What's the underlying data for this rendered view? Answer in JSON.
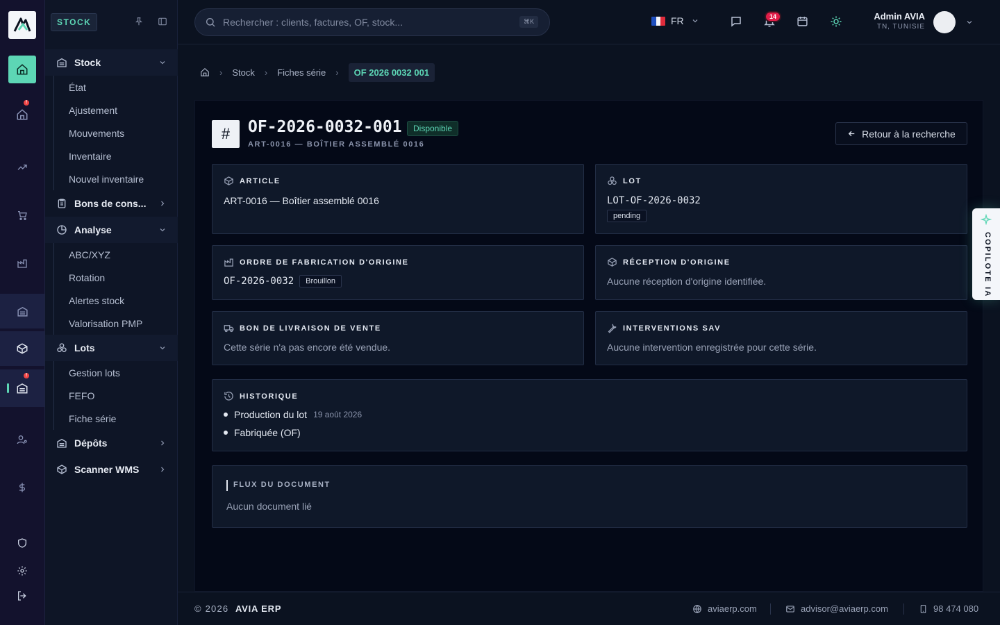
{
  "sidebar": {
    "module_tag": "STOCK",
    "groups": [
      {
        "label": "Stock",
        "items": [
          "État",
          "Ajustement",
          "Mouvements",
          "Inventaire",
          "Nouvel inventaire"
        ]
      },
      {
        "label": "Bons de cons..."
      },
      {
        "label": "Analyse",
        "items": [
          "ABC/XYZ",
          "Rotation",
          "Alertes stock",
          "Valorisation PMP"
        ]
      },
      {
        "label": "Lots",
        "items": [
          "Gestion lots",
          "FEFO",
          "Fiche série"
        ]
      },
      {
        "label": "Dépôts"
      },
      {
        "label": "Scanner WMS"
      }
    ]
  },
  "topbar": {
    "search_placeholder": "Rechercher : clients, factures, OF, stock...",
    "search_shortcut": "⌘K",
    "language": "FR",
    "notifications_count": "14",
    "user_name": "Admin AVIA",
    "user_location": "TN, TUNISIE"
  },
  "breadcrumb": [
    "Stock",
    "Fiches série",
    "OF 2026 0032 001"
  ],
  "detail": {
    "title": "OF-2026-0032-001",
    "status": "Disponible",
    "subtitle": "ART-0016 — BOÎTIER ASSEMBLÉ 0016",
    "back_label": "Retour à la recherche",
    "article": {
      "heading": "ARTICLE",
      "value": "ART-0016 — Boîtier assemblé 0016"
    },
    "lot": {
      "heading": "LOT",
      "value": "LOT-OF-2026-0032",
      "chip": "pending"
    },
    "of_origin": {
      "heading": "ORDRE DE FABRICATION D'ORIGINE",
      "value": "OF-2026-0032",
      "chip": "Brouillon"
    },
    "reception": {
      "heading": "RÉCEPTION D'ORIGINE",
      "text": "Aucune réception d'origine identifiée."
    },
    "delivery": {
      "heading": "BON DE LIVRAISON DE VENTE",
      "text": "Cette série n'a pas encore été vendue."
    },
    "sav": {
      "heading": "INTERVENTIONS SAV",
      "text": "Aucune intervention enregistrée pour cette série."
    },
    "history": {
      "heading": "HISTORIQUE",
      "events": [
        {
          "label": "Production du lot",
          "date": "19 août 2026"
        },
        {
          "label": "Fabriquée (OF)",
          "date": ""
        }
      ]
    },
    "flux": {
      "heading": "FLUX DU DOCUMENT",
      "text": "Aucun document lié"
    }
  },
  "copilot": {
    "label": "COPILOTE IA"
  },
  "footer": {
    "year": "2026",
    "brand": "AVIA ERP",
    "website": "aviaerp.com",
    "email": "advisor@aviaerp.com",
    "phone": "98 474 080"
  },
  "colors": {
    "accent": "#5dd6b5",
    "background": "#0b1220",
    "rail": "#13122d",
    "alert": "#ef4444"
  }
}
